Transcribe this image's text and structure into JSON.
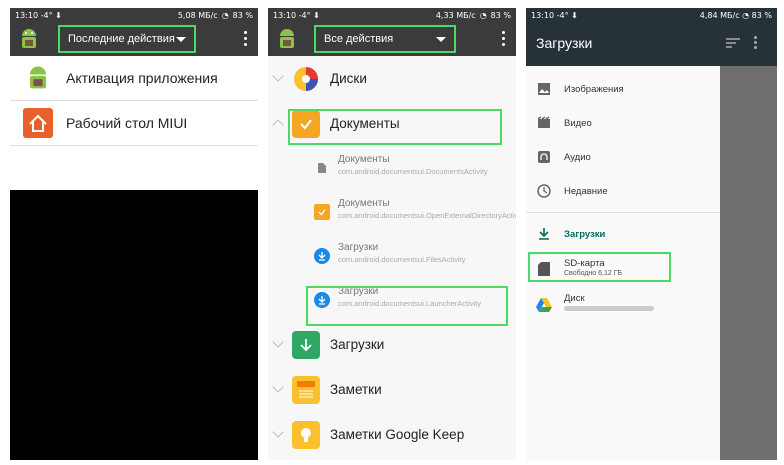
{
  "panel1": {
    "status": {
      "time": "13:10",
      "extra": "-4° ⬇",
      "speed": "5,08 МБ/с",
      "battery": "83 %"
    },
    "spinner_label": "Последние действия",
    "items": [
      {
        "label": "Активация приложения",
        "icon": "android-icon"
      },
      {
        "label": "Рабочий стол MIUI",
        "icon": "home-icon"
      }
    ]
  },
  "panel2": {
    "status": {
      "time": "13:10",
      "extra": "-4° ⬇",
      "speed": "4,33 МБ/с",
      "battery": "83 %"
    },
    "spinner_label": "Все действия",
    "groups": [
      {
        "label": "Диски"
      },
      {
        "label": "Документы"
      },
      {
        "label": "Загрузки"
      },
      {
        "label": "Заметки"
      },
      {
        "label": "Заметки Google Keep"
      }
    ],
    "activities": [
      {
        "title": "Документы",
        "sub": "com.android.documentsui.DocumentsActivity"
      },
      {
        "title": "Документы",
        "sub": "com.android.documentsui.OpenExternalDirectoryActivity"
      },
      {
        "title": "Загрузки",
        "sub": "com.android.documentsui.FilesActivity"
      },
      {
        "title": "Загрузки",
        "sub": "com.android.documentsui.LauncherActivity"
      }
    ]
  },
  "panel3": {
    "status": {
      "time": "13:10",
      "extra": "-4° ⬇",
      "speed": "4,84 МБ/с",
      "battery": "83 %"
    },
    "title": "Загрузки",
    "items": [
      {
        "label": "Изображения",
        "icon": "image-icon"
      },
      {
        "label": "Видео",
        "icon": "video-icon"
      },
      {
        "label": "Аудио",
        "icon": "headphones-icon"
      },
      {
        "label": "Недавние",
        "icon": "clock-icon"
      }
    ],
    "downloads_label": "Загрузки",
    "sd_label": "SD-карта",
    "sd_free": "Свободно 6,12 ГБ",
    "drive_label": "Диск"
  },
  "colors": {
    "highlight": "#4cd964",
    "accent": "#00695c",
    "toolbar": "#3b3b3b",
    "header": "#263238"
  }
}
